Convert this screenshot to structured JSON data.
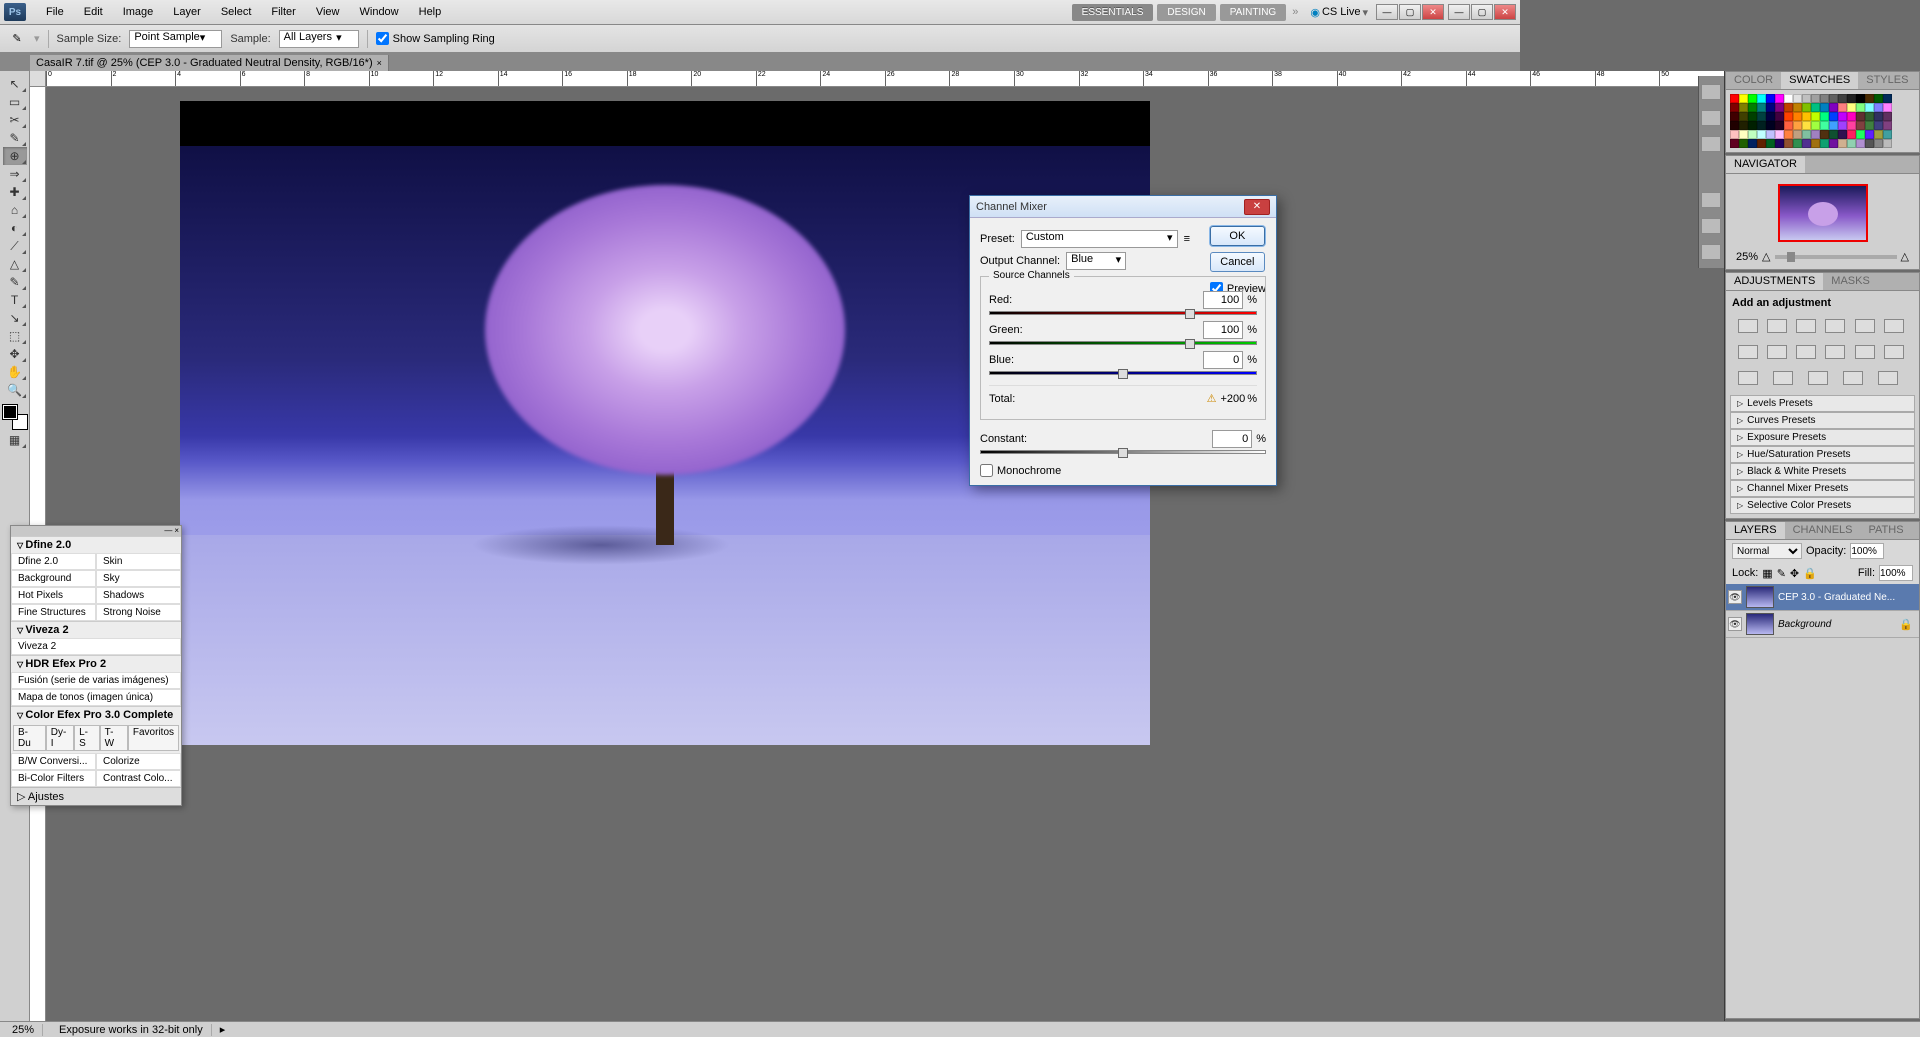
{
  "menubar": {
    "items": [
      "File",
      "Edit",
      "Image",
      "Layer",
      "Select",
      "Filter",
      "View",
      "Window",
      "Help"
    ]
  },
  "workspaces": {
    "essentials": "ESSENTIALS",
    "design": "DESIGN",
    "painting": "PAINTING",
    "cslive": "CS Live"
  },
  "options": {
    "sample_size_label": "Sample Size:",
    "sample_size_value": "Point Sample",
    "sample_label": "Sample:",
    "sample_value": "All Layers",
    "show_ring": "Show Sampling Ring"
  },
  "doc_tab": {
    "title": "CasaIR 7.tif @ 25% (CEP 3.0 - Graduated Neutral Density, RGB/16*)",
    "suffix": "×"
  },
  "toolbox_glyphs": [
    "↖",
    "▭",
    "✂",
    "✎",
    "⊕",
    "⇒",
    "✚",
    "⌂",
    "◐",
    "⟋",
    "△",
    "✎",
    "T",
    "↘",
    "⬚",
    "✥",
    "✋",
    "🔍"
  ],
  "panels": {
    "color_tabs": [
      "COLOR",
      "SWATCHES",
      "STYLES"
    ],
    "navigator": {
      "tab": "NAVIGATOR",
      "zoom": "25%"
    },
    "adjustments": {
      "tabs": [
        "ADJUSTMENTS",
        "MASKS"
      ],
      "heading": "Add an adjustment",
      "presets": [
        "Levels Presets",
        "Curves Presets",
        "Exposure Presets",
        "Hue/Saturation Presets",
        "Black & White Presets",
        "Channel Mixer Presets",
        "Selective Color Presets"
      ]
    },
    "layers": {
      "tabs": [
        "LAYERS",
        "CHANNELS",
        "PATHS"
      ],
      "blend": "Normal",
      "opacity_label": "Opacity:",
      "opacity": "100%",
      "lock_label": "Lock:",
      "fill_label": "Fill:",
      "fill": "100%",
      "rows": [
        {
          "name": "CEP 3.0 - Graduated Ne...",
          "active": true
        },
        {
          "name": "Background",
          "active": false
        }
      ]
    }
  },
  "float": {
    "sections": [
      {
        "title": "Dfine 2.0",
        "grid": [
          [
            "Dfine 2.0",
            "Skin"
          ],
          [
            "Background",
            "Sky"
          ],
          [
            "Hot Pixels",
            "Shadows"
          ],
          [
            "Fine Structures",
            "Strong Noise"
          ]
        ]
      },
      {
        "title": "Viveza 2",
        "grid": [
          [
            "Viveza 2",
            ""
          ]
        ]
      },
      {
        "title": "HDR Efex Pro 2",
        "grid": [
          [
            "Fusión (serie de varias imágenes)",
            ""
          ],
          [
            "Mapa de tonos (imagen única)",
            ""
          ]
        ]
      },
      {
        "title": "Color Efex Pro 3.0 Complete",
        "tabs": [
          "B-Du",
          "Dy-I",
          "L-S",
          "T-W",
          "Favoritos"
        ],
        "grid": [
          [
            "B/W Conversi...",
            "Colorize"
          ],
          [
            "Bi-Color Filters",
            "Contrast Colo..."
          ]
        ]
      }
    ],
    "footer": "Ajustes"
  },
  "dialog": {
    "title": "Channel Mixer",
    "preset_label": "Preset:",
    "preset_value": "Custom",
    "output_label": "Output Channel:",
    "output_value": "Blue",
    "ok": "OK",
    "cancel": "Cancel",
    "preview": "Preview",
    "source_legend": "Source Channels",
    "channels": [
      {
        "name": "Red:",
        "value": "100",
        "pct": "%"
      },
      {
        "name": "Green:",
        "value": "100",
        "pct": "%"
      },
      {
        "name": "Blue:",
        "value": "0",
        "pct": "%"
      }
    ],
    "total_label": "Total:",
    "total_warn": "⚠",
    "total_value": "+200",
    "total_pct": "%",
    "constant_label": "Constant:",
    "constant_value": "0",
    "constant_pct": "%",
    "monochrome": "Monochrome"
  },
  "status": {
    "zoom": "25%",
    "info": "Exposure works in 32-bit only"
  },
  "swatch_rows": [
    [
      "#ff0000",
      "#ffff00",
      "#00ff00",
      "#00ffff",
      "#0000ff",
      "#ff00ff",
      "#ffffff",
      "#e0e0e0",
      "#c0c0c0",
      "#a0a0a0",
      "#808080",
      "#606060",
      "#404040",
      "#202020",
      "#000000",
      "#4a2a00",
      "#005a00",
      "#002a5a"
    ],
    [
      "#800000",
      "#808000",
      "#008000",
      "#008080",
      "#000080",
      "#800080",
      "#c04000",
      "#c08000",
      "#80c000",
      "#00c080",
      "#0080c0",
      "#8000c0",
      "#ff8080",
      "#ffff80",
      "#80ff80",
      "#80ffff",
      "#8080ff",
      "#ff80ff"
    ],
    [
      "#400000",
      "#404000",
      "#004000",
      "#004040",
      "#000040",
      "#400040",
      "#ff4000",
      "#ff8000",
      "#ffc000",
      "#c0ff00",
      "#00ff80",
      "#0040ff",
      "#c000ff",
      "#ff00c0",
      "#603030",
      "#306030",
      "#303060",
      "#603060"
    ],
    [
      "#200000",
      "#202000",
      "#002000",
      "#002020",
      "#000020",
      "#200020",
      "#ff6040",
      "#ffa040",
      "#ffe040",
      "#a0ff40",
      "#40ffa0",
      "#40a0ff",
      "#a040ff",
      "#ff40a0",
      "#804040",
      "#408040",
      "#404080",
      "#804080"
    ],
    [
      "#ffc0c0",
      "#ffffc0",
      "#c0ffc0",
      "#c0ffff",
      "#c0c0ff",
      "#ffc0ff",
      "#ff8040",
      "#c0a080",
      "#80c0a0",
      "#a080c0",
      "#503010",
      "#105030",
      "#301050",
      "#ff2060",
      "#20ff60",
      "#6020ff",
      "#a0a040",
      "#40a0a0"
    ],
    [
      "#600020",
      "#206000",
      "#002060",
      "#602000",
      "#006020",
      "#200060",
      "#905030",
      "#309050",
      "#503090",
      "#a07010",
      "#10a070",
      "#7010a0",
      "#d0b090",
      "#90d0b0",
      "#b090d0",
      "#555555",
      "#888888",
      "#bbbbbb"
    ]
  ]
}
